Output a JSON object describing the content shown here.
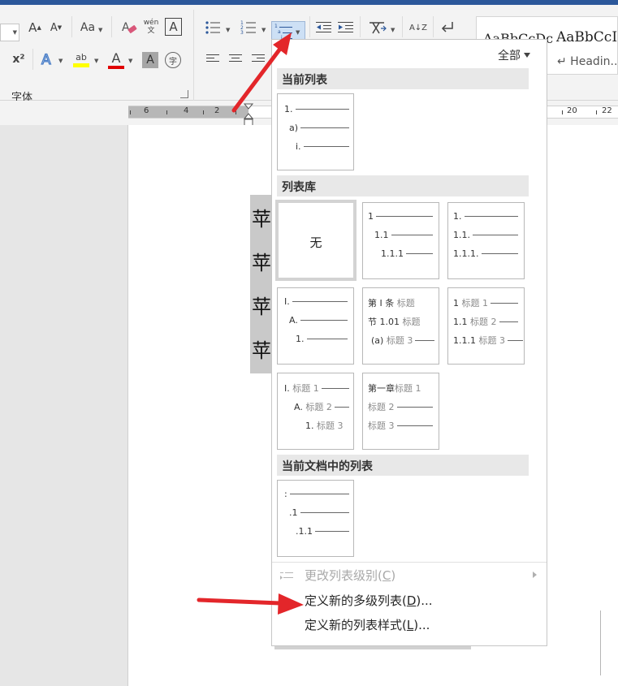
{
  "ribbon": {
    "font_group_label": "字体",
    "change_case_label": "Aa",
    "phonetic_label": "wén\n文",
    "char_border_label": "A",
    "superscript_label": "x²",
    "font_color_label": "A",
    "highlight_label": "ab",
    "char_shade_label": "A",
    "enclose_char_label": "字",
    "sort_label": "A↓Z",
    "colors": {
      "highlight": "#ffff00",
      "font_color": "#e00000",
      "text_effect": "#4a7ec7",
      "accent": "#2b579a"
    }
  },
  "styles": {
    "sample_1": "AaBbCcDc",
    "sample_2": "AaBbCcI",
    "heading_label": "↵ Headin..."
  },
  "ruler": {
    "numbers": [
      "6",
      "4",
      "2",
      "20",
      "22"
    ]
  },
  "document": {
    "lines": [
      "苹",
      "苹",
      "苹",
      "苹"
    ]
  },
  "dropdown": {
    "filter_label": "全部",
    "current_list_header": "当前列表",
    "library_header": "列表库",
    "doc_lists_header": "当前文档中的列表",
    "current_tile": [
      "1.",
      "a)",
      "i."
    ],
    "library_tiles": [
      {
        "kind": "none",
        "label": "无"
      },
      {
        "rows": [
          "1",
          "1.1",
          "1.1.1"
        ]
      },
      {
        "rows": [
          "1.",
          "1.1.",
          "1.1.1."
        ]
      },
      {
        "rows": [
          "I.",
          "A.",
          "1."
        ]
      },
      {
        "rows": [
          [
            "第 I 条",
            "标题"
          ],
          [
            "节 1.01",
            "标题"
          ],
          [
            "(a)",
            "标题 3"
          ]
        ]
      },
      {
        "rows": [
          [
            "1",
            "标题 1"
          ],
          [
            "1.1",
            "标题 2"
          ],
          [
            "1.1.1",
            "标题 3"
          ]
        ]
      },
      {
        "rows": [
          [
            "I.",
            "标题 1"
          ],
          [
            "A.",
            "标题 2"
          ],
          [
            "1.",
            "标题 3"
          ]
        ]
      },
      {
        "rows": [
          [
            "第一章",
            "标题 1"
          ],
          [
            "",
            "标题 2"
          ],
          [
            "",
            "标题 3"
          ]
        ]
      }
    ],
    "doc_tile": [
      ":",
      ".1",
      ".1.1"
    ],
    "menu": {
      "change_level": "更改列表级别(",
      "change_level_key": "C",
      "define_multilevel": "定义新的多级列表(",
      "define_multilevel_key": "D",
      "define_style": "定义新的列表样式(",
      "define_style_key": "L",
      "suffix": ")..."
    }
  },
  "annotation_color": "#e3262a"
}
